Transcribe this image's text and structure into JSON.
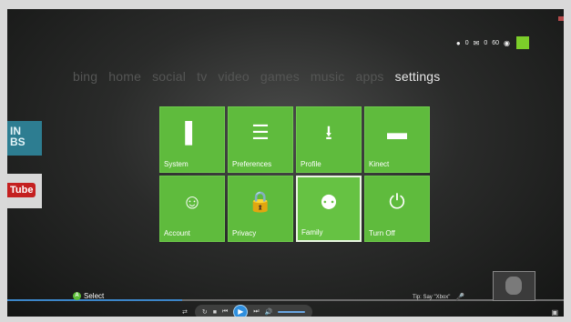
{
  "status": {
    "wireless_count": "0",
    "messages_count": "0",
    "gamerscore": "60",
    "icons": [
      "controller-icon",
      "message-icon",
      "gamerscore-icon",
      "avatar"
    ],
    "accent": "#7ccd2a"
  },
  "nav": [
    {
      "label": "bing"
    },
    {
      "label": "home"
    },
    {
      "label": "social"
    },
    {
      "label": "tv"
    },
    {
      "label": "video"
    },
    {
      "label": "games"
    },
    {
      "label": "music"
    },
    {
      "label": "apps"
    },
    {
      "label": "settings",
      "active": true
    }
  ],
  "side_tiles": {
    "msn": "IN\nBS",
    "youtube": "Tube"
  },
  "tiles": [
    {
      "label": "System",
      "icon": "console-icon"
    },
    {
      "label": "Preferences",
      "icon": "list-icon"
    },
    {
      "label": "Profile",
      "icon": "profile-card-icon"
    },
    {
      "label": "Kinect",
      "icon": "kinect-icon"
    },
    {
      "label": "Account",
      "icon": "account-icon"
    },
    {
      "label": "Privacy",
      "icon": "lock-icon"
    },
    {
      "label": "Family",
      "icon": "family-icon",
      "selected": true
    },
    {
      "label": "Turn Off",
      "icon": "power-icon"
    }
  ],
  "footer": {
    "button_glyph": "A",
    "select_label": "Select",
    "tip": "Tip: Say \"Xbox\"",
    "tile_color": "#5fbb3d",
    "focus_color": "#3c86c9"
  }
}
